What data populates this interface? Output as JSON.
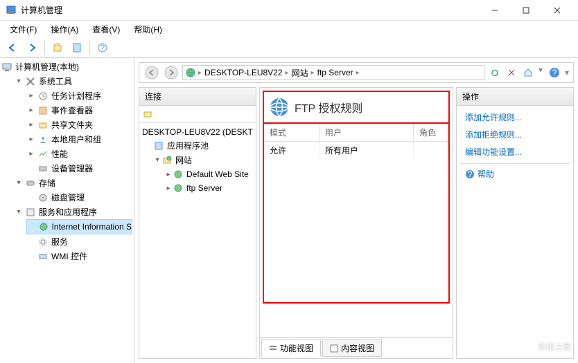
{
  "window": {
    "title": "计算机管理"
  },
  "menubar": {
    "file": "文件(F)",
    "action": "操作(A)",
    "view": "查看(V)",
    "help": "帮助(H)"
  },
  "left_tree": {
    "root": "计算机管理(本地)",
    "system_tools": "系统工具",
    "task_scheduler": "任务计划程序",
    "event_viewer": "事件查看器",
    "shared_folders": "共享文件夹",
    "local_users": "本地用户和组",
    "performance": "性能",
    "device_manager": "设备管理器",
    "storage": "存储",
    "disk_mgmt": "磁盘管理",
    "services_apps": "服务和应用程序",
    "iis": "Internet Information S",
    "services": "服务",
    "wmi": "WMI 控件"
  },
  "breadcrumb": {
    "seg1": "DESKTOP-LEU8V22",
    "seg2": "网站",
    "seg3": "ftp Server"
  },
  "connections": {
    "header": "连接",
    "root": "DESKTOP-LEU8V22 (DESKT",
    "app_pools": "应用程序池",
    "sites": "网站",
    "default_site": "Default Web Site",
    "ftp_server": "ftp Server"
  },
  "feature": {
    "title": "FTP 授权规则",
    "columns": {
      "mode": "模式",
      "user": "用户",
      "role": "角色"
    },
    "rows": [
      {
        "mode": "允许",
        "user": "所有用户",
        "role": ""
      }
    ]
  },
  "tabs": {
    "feature_view": "功能视图",
    "content_view": "内容视图"
  },
  "actions": {
    "header": "操作",
    "add_allow": "添加允许规则...",
    "add_deny": "添加拒绝规则...",
    "edit_feature": "编辑功能设置...",
    "help": "帮助"
  },
  "watermark": "系统之家"
}
